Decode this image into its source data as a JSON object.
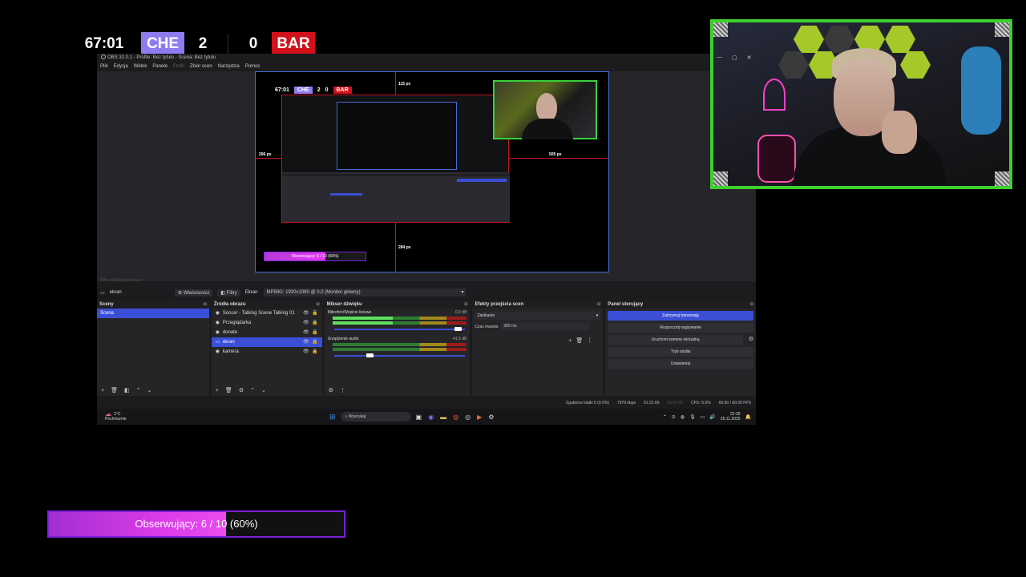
{
  "scoreboard": {
    "time": "67:01",
    "home_team": "CHE",
    "home_score": "2",
    "away_score": "0",
    "away_team": "BAR",
    "home_color": "#8f7bf0",
    "away_color": "#d3111b"
  },
  "obs": {
    "title": "OBS 32.0.1 - Profile: Bez tytułu - Scena: Bez tytułu",
    "menu": [
      "Plik",
      "Edycja",
      "Widok",
      "Panele",
      "Profil",
      "Zbiór scen",
      "Narzędzia",
      "Pomoc"
    ],
    "preview": {
      "labels": {
        "top": "115 px",
        "left": "206 px",
        "right": "505 px",
        "bottom": "284 px"
      },
      "mini_score": {
        "time": "67:01",
        "home": "CHE",
        "home_score": "2",
        "away_score": "0",
        "away": "BAR"
      },
      "mini_follow": "Obserwujący: 6 / 10 (60%)"
    },
    "zoom_row": "50%   ▾   Skaluj do okna   ▾",
    "props_bar": {
      "source_name": "ekran",
      "properties_label": "Właściwości",
      "filters_label": "Filtry",
      "screen_label": "Ekran",
      "monitor_select": "MP59G: 1920x1080 @ 0,0 (Monitor główny)"
    },
    "docks": {
      "scenes": {
        "title": "Sceny",
        "items": [
          "Scena"
        ]
      },
      "sources": {
        "title": "Źródła obrazu",
        "items": [
          {
            "icon": "◉",
            "label": "Soccer - Talking Scene Talking 01"
          },
          {
            "icon": "◉",
            "label": "Przeglądarka"
          },
          {
            "icon": "◉",
            "label": "donate"
          },
          {
            "icon": "▭",
            "label": "ekran"
          },
          {
            "icon": "◉",
            "label": "kamera"
          }
        ]
      },
      "mixer": {
        "title": "Mikser dźwięku",
        "channels": [
          {
            "name": "Mikrofon/Wejście liniowe",
            "db": "0.0 dB",
            "level": 0.45,
            "volume": 0.97
          },
          {
            "name": "Urządzenie audio",
            "db": "-41.5 dB",
            "level": 0.0,
            "volume": 0.3
          }
        ]
      },
      "transitions": {
        "title": "Efekty przejścia scen",
        "selected": "Zanikanie",
        "duration_label": "Czas trwania",
        "duration_value": "300 ms"
      },
      "controls": {
        "title": "Panel sterujący",
        "buttons": [
          "Zatrzymaj transmisję",
          "Rozpocznij nagrywanie",
          "Uruchom kamerę wirtualną",
          "Tryb studia",
          "Ustawienia"
        ]
      }
    },
    "status": {
      "dropped": "Zgubione klatki 0 (0.0%)",
      "bitrate": "7979 kbps",
      "stream_time": "01:22:06",
      "rec_time": "00:00:00",
      "cpu": "CPU: 6.0%",
      "fps": "60.00 / 60.00 FPS"
    },
    "taskbar": {
      "weather_temp": "1°C",
      "weather_desc": "Pochmurnie",
      "search_placeholder": "Wyszukaj",
      "time": "22:26",
      "date": "25.11.2025"
    }
  },
  "follow_goal": {
    "label": "Obserwujący:",
    "current": 6,
    "goal": 10,
    "text": "Obserwujący: 6 / 10 (60%)",
    "progress": 0.6
  }
}
